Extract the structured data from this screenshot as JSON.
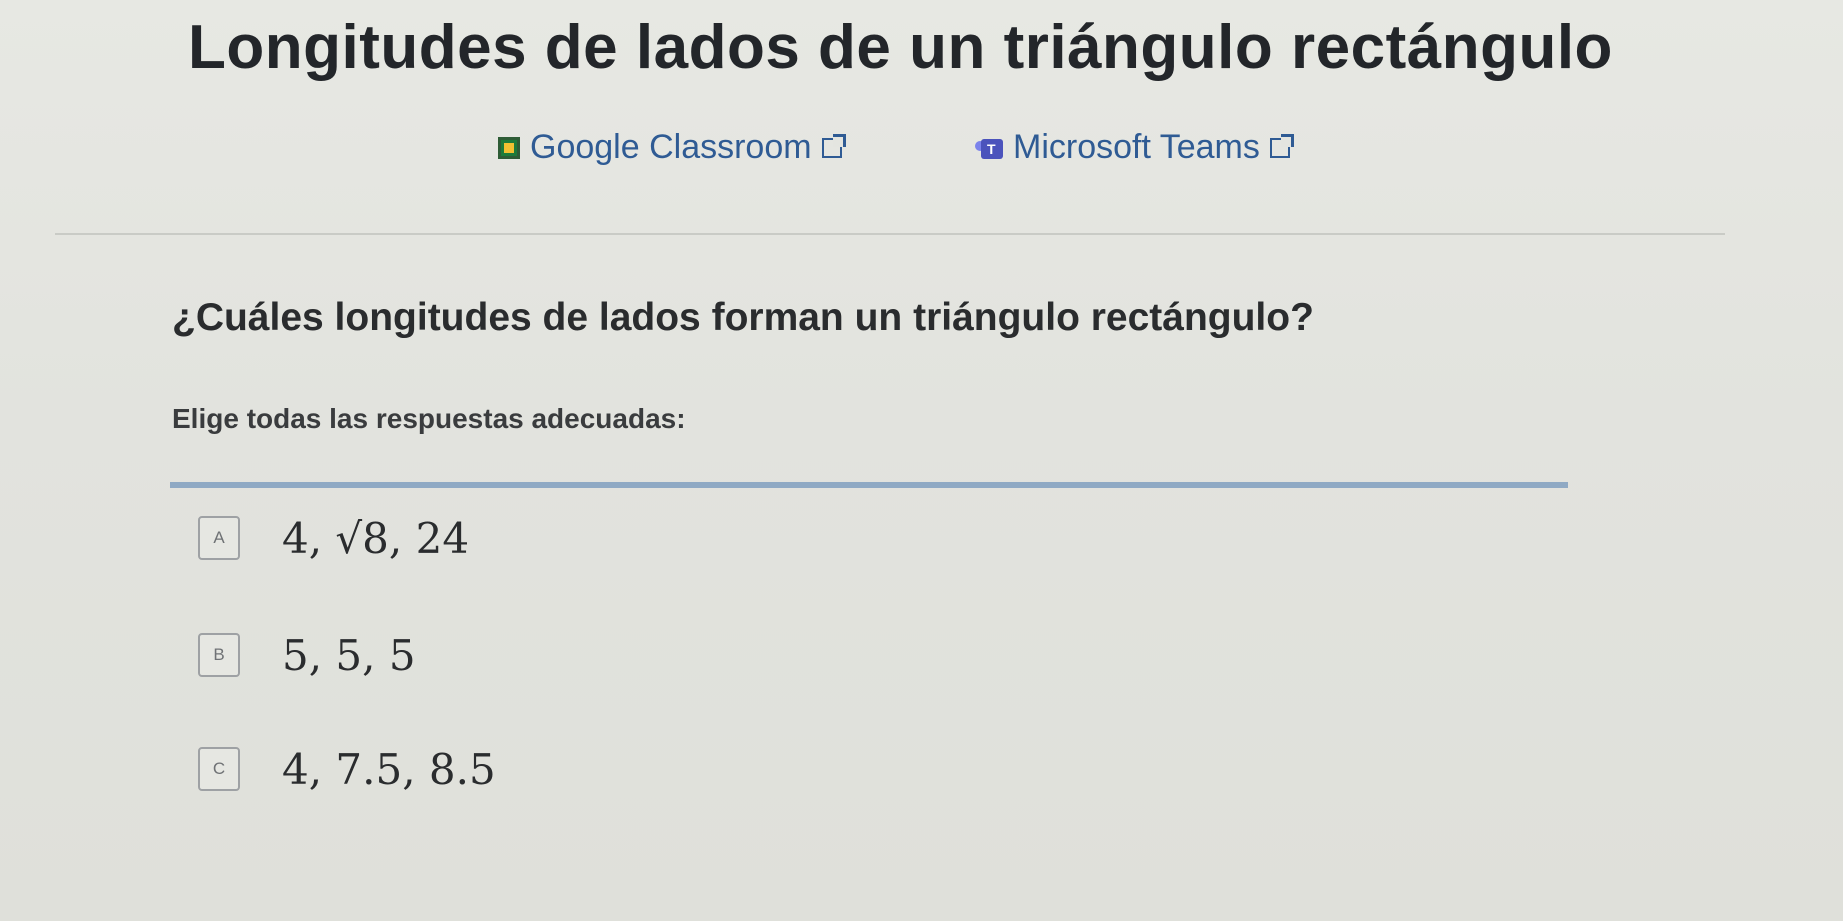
{
  "header": {
    "title": "Longitudes de lados de un triángulo rectángulo"
  },
  "share": {
    "google_classroom_label": "Google Classroom",
    "microsoft_teams_label": "Microsoft Teams"
  },
  "question": {
    "prompt": "¿Cuáles longitudes de lados forman un triángulo rectángulo?",
    "instruction": "Elige todas las respuestas adecuadas:"
  },
  "choices": [
    {
      "letter": "A",
      "text": "4, √8, 24",
      "selected": false
    },
    {
      "letter": "B",
      "text": "5, 5, 5",
      "selected": false
    },
    {
      "letter": "C",
      "text": "4, 7.5, 8.5",
      "selected": false
    }
  ],
  "colors": {
    "link": "#2f5b94",
    "rule": "#8fa9c4",
    "background": "#e4e5e0"
  }
}
